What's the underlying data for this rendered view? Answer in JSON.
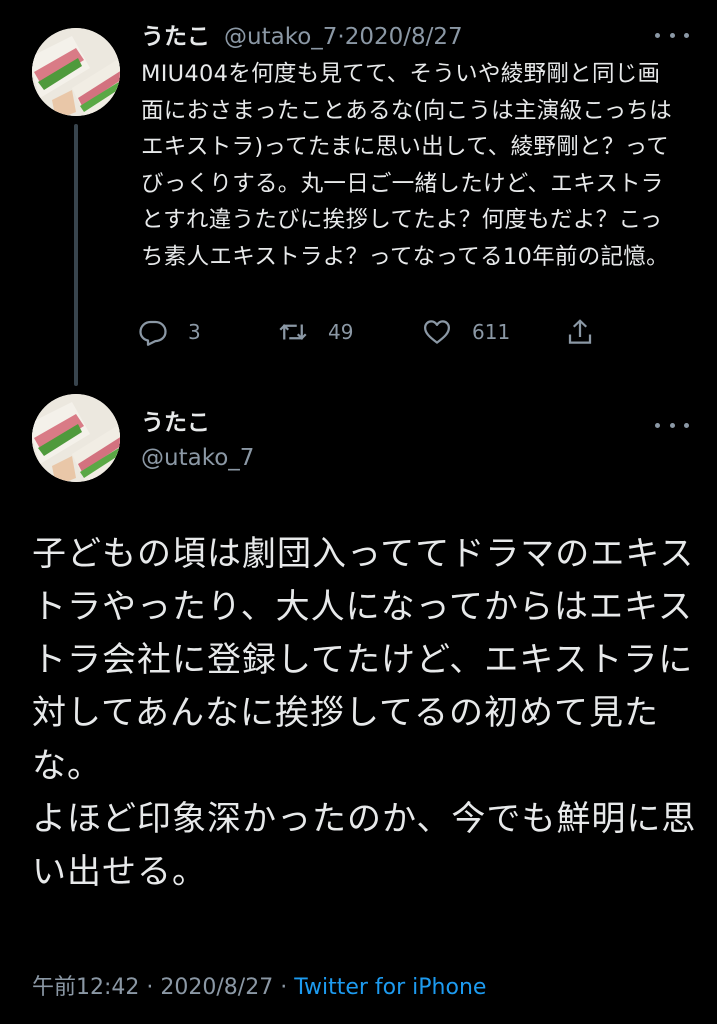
{
  "parent_tweet": {
    "name": "うたこ",
    "handle": "@utako_7",
    "separator": "·",
    "date": "2020/8/27",
    "text": "MIU404を何度も見てて、そういや綾野剛と同じ画面におさまったことあるな(向こうは主演級こっちはエキストラ)ってたまに思い出して、綾野剛と？ってびっくりする。丸一日ご一緒したけど、エキストラとすれ違うたびに挨拶してたよ？何度もだよ？こっち素人エキストラよ？ってなってる10年前の記憶。",
    "replies": "3",
    "retweets": "49",
    "likes": "611"
  },
  "main_tweet": {
    "name": "うたこ",
    "handle": "@utako_7",
    "text": "子どもの頃は劇団入っててドラマのエキストラやったり、大人になってからはエキストラ会社に登録してたけど、エキストラに対してあんなに挨拶してるの初めて見たな。\nよほど印象深かったのか、今でも鮮明に思い出せる。",
    "time": "午前12:42",
    "separator1": " · ",
    "date": "2020/8/27",
    "separator2": " · ",
    "source": "Twitter for iPhone"
  },
  "icons": {
    "reply": "reply-icon",
    "retweet": "retweet-icon",
    "like": "heart-icon",
    "share": "share-icon",
    "more": "more-options-icon"
  },
  "colors": {
    "background": "#000000",
    "text": "#e7e9ea",
    "secondary": "#8b98a5",
    "link": "#1d9bf0",
    "thread_line": "#38444d"
  }
}
